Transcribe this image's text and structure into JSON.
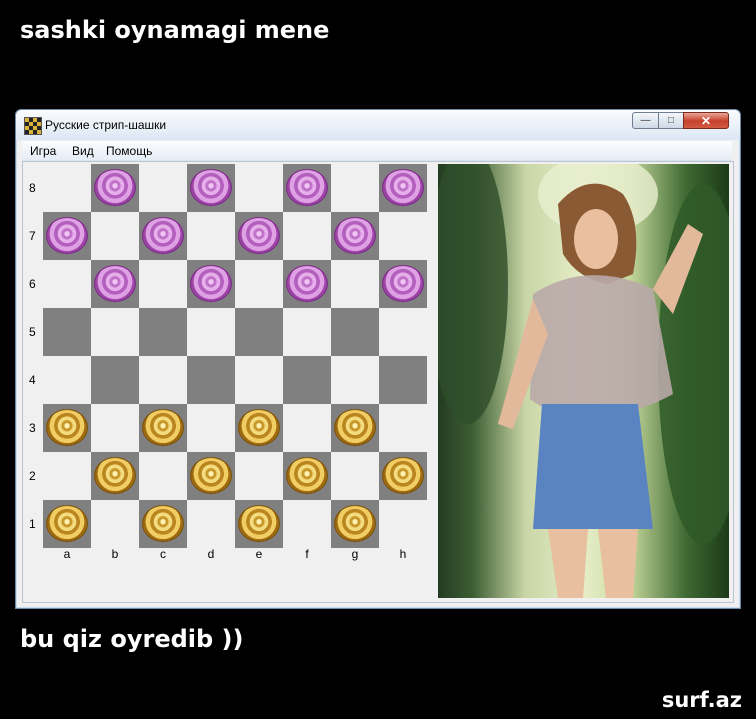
{
  "captions": {
    "top": "sashki oynamagi mene",
    "bottom": "bu qiz oyredib ))",
    "site": "surf.az"
  },
  "window": {
    "title": "Русские стрип-шашки",
    "icon": "checkerboard-icon",
    "controls": {
      "minimize": "—",
      "maximize": "□",
      "close": "✕"
    }
  },
  "menu": [
    "Игра",
    "Вид",
    "Помощь"
  ],
  "board": {
    "rows": [
      "8",
      "7",
      "6",
      "5",
      "4",
      "3",
      "2",
      "1"
    ],
    "columns": [
      "a",
      "b",
      "c",
      "d",
      "e",
      "f",
      "g",
      "h"
    ],
    "pieces": {
      "pink": [
        "b8",
        "d8",
        "f8",
        "h8",
        "a7",
        "c7",
        "e7",
        "g7",
        "b6",
        "d6",
        "f6",
        "h6"
      ],
      "gold": [
        "a3",
        "c3",
        "e3",
        "g3",
        "b2",
        "d2",
        "f2",
        "h2",
        "a1",
        "c1",
        "e1",
        "g1"
      ]
    },
    "colors": {
      "light": "#f0f0f0",
      "dark": "#808080",
      "pink": "#c074c8",
      "gold": "#e6b840"
    }
  },
  "photo": {
    "description_icon": "photo-image"
  }
}
